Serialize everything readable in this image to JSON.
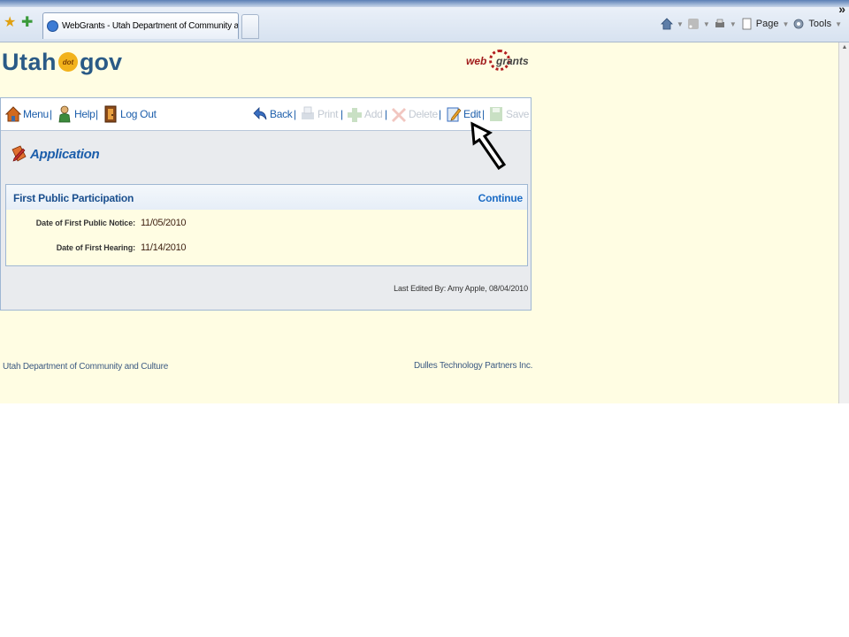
{
  "browser": {
    "tab_title": "WebGrants - Utah Department of Community and Cult...",
    "commands": {
      "page": "Page",
      "tools": "Tools"
    },
    "more": "»"
  },
  "header": {
    "logo_utah": "Utah",
    "logo_dot": "dot",
    "logo_gov": "gov",
    "webgrants_left": "web",
    "webgrants_right": "grants"
  },
  "toolbar": {
    "menu": "Menu",
    "help": "Help",
    "logout": "Log Out",
    "back": "Back",
    "print": "Print",
    "add": "Add",
    "delete": "Delete",
    "edit": "Edit",
    "save": "Save",
    "separator": "|"
  },
  "page": {
    "title": "Application",
    "section_title": "First Public Participation",
    "continue_link": "Continue",
    "fields": [
      {
        "label": "Date of First Public Notice:",
        "value": "11/05/2010"
      },
      {
        "label": "Date of First Hearing:",
        "value": "11/14/2010"
      }
    ],
    "last_edited": "Last Edited By: Amy Apple, 08/04/2010"
  },
  "footer": {
    "left": "Utah Department of Community and Culture",
    "right": "Dulles Technology Partners Inc."
  },
  "colors": {
    "page_bg": "#fffde3",
    "link_blue": "#1c5eab",
    "disabled": "#c2c9d2",
    "border": "#9fb7d3"
  }
}
